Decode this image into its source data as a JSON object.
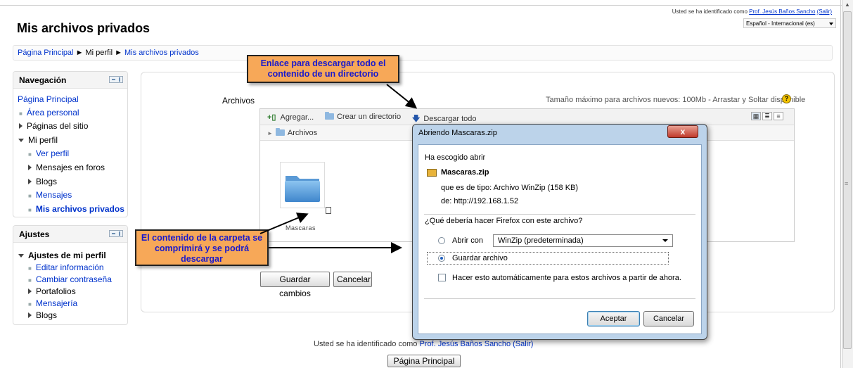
{
  "header": {
    "title": "Mis archivos privados",
    "login_prefix": "Usted se ha identificado como",
    "login_user": "Prof. Jesús Baños Sancho",
    "login_logout": "(Salir)",
    "language": "Español - Internacional (es)"
  },
  "breadcrumb": {
    "items": [
      "Página Principal",
      "Mi perfil",
      "Mis archivos privados"
    ],
    "separator": "►"
  },
  "navigation": {
    "title": "Navegación",
    "items": [
      "Página Principal",
      "Área personal",
      "Páginas del sitio",
      "Mi perfil",
      "Ver perfil",
      "Mensajes en foros",
      "Blogs",
      "Mensajes",
      "Mis archivos privados"
    ]
  },
  "settings": {
    "title": "Ajustes",
    "items": [
      "Ajustes de mi perfil",
      "Editar información",
      "Cambiar contraseña",
      "Portafolios",
      "Mensajería",
      "Blogs"
    ]
  },
  "files": {
    "label": "Archivos",
    "max_size_text": "Tamaño máximo para archivos nuevos: 100Mb - Arrastar y Soltar disponible",
    "toolbar": {
      "add": "Agregar...",
      "create_dir": "Crear un directorio",
      "download_all": "Descargar todo"
    },
    "path": "Archivos",
    "folder_name": "Mascaras",
    "save_button": "Guardar cambios",
    "cancel_button": "Cancelar"
  },
  "dialog": {
    "title": "Abriendo Mascaras.zip",
    "close": "x",
    "chosen_open": "Ha escogido abrir",
    "file_name": "Mascaras.zip",
    "type_label": "que es de tipo:",
    "type_value": "Archivo WinZip (158 KB)",
    "from_label": "de:",
    "from_value": "http://192.168.1.52",
    "question": "¿Qué debería hacer Firefox con este archivo?",
    "open_with": "Abrir con",
    "open_with_app": "WinZip (predeterminada)",
    "save_file": "Guardar archivo",
    "auto_text": "Hacer esto automáticamente para estos archivos a partir de ahora.",
    "accept": "Aceptar",
    "cancel": "Cancelar"
  },
  "callouts": {
    "download_all": "Enlace para descargar todo el contenido de un directorio",
    "folder_zip": "El contenido de la carpeta se comprimirá y se podrá descargar"
  },
  "footer": {
    "login_prefix": "Usted se ha identificado como",
    "login_user": "Prof. Jesús Baños Sancho",
    "login_logout": "(Salir)",
    "home_button": "Página Principal"
  },
  "colors": {
    "link": "#0033cc",
    "callout_fill": "#f7a858",
    "callout_text": "#1a1acc",
    "dialog_frame": "#bcd3ea",
    "close_button": "#c0392b"
  }
}
